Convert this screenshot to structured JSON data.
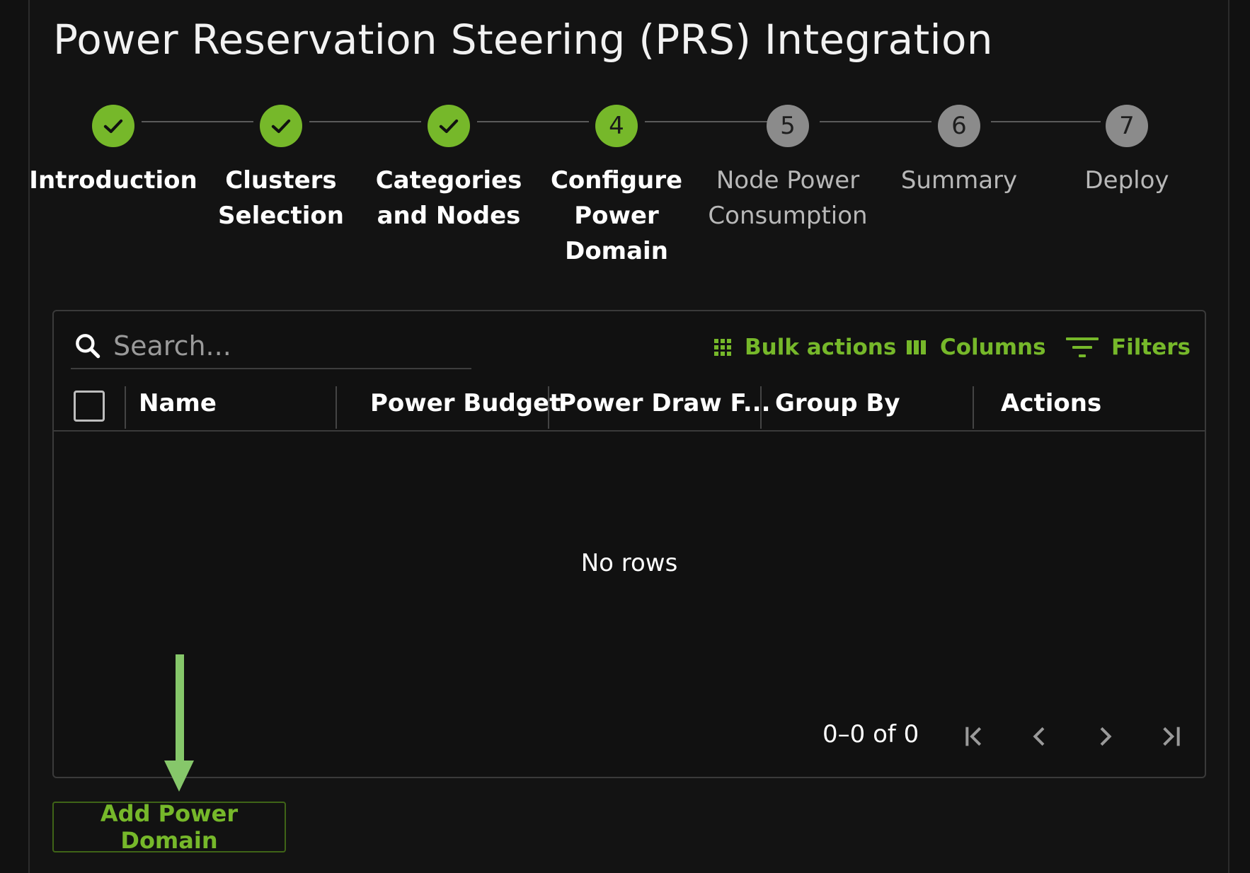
{
  "page": {
    "title": "Power Reservation Steering (PRS) Integration"
  },
  "stepper": {
    "steps": [
      {
        "number": "1",
        "label": "Introduction",
        "state": "done"
      },
      {
        "number": "2",
        "label": "Clusters\nSelection",
        "state": "done"
      },
      {
        "number": "3",
        "label": "Categories\nand Nodes",
        "state": "done"
      },
      {
        "number": "4",
        "label": "Configure\nPower\nDomain",
        "state": "active"
      },
      {
        "number": "5",
        "label": "Node Power\nConsumption",
        "state": "pending"
      },
      {
        "number": "6",
        "label": "Summary",
        "state": "pending"
      },
      {
        "number": "7",
        "label": "Deploy",
        "state": "pending"
      }
    ]
  },
  "grid": {
    "search": {
      "placeholder": "Search...",
      "value": "",
      "icon": "search-icon"
    },
    "toolbar": {
      "bulk_actions": {
        "label": "Bulk actions",
        "icon": "grid-dots-icon"
      },
      "columns": {
        "label": "Columns",
        "icon": "columns-icon"
      },
      "filters": {
        "label": "Filters",
        "icon": "filter-icon"
      }
    },
    "columns": [
      "Name",
      "Power Budget",
      "Power Draw F...",
      "Group By",
      "Actions"
    ],
    "rows": [],
    "empty_text": "No rows",
    "pagination": {
      "range_text": "0–0 of 0",
      "icons": [
        "first-page-icon",
        "previous-page-icon",
        "next-page-icon",
        "last-page-icon"
      ]
    }
  },
  "actions": {
    "add_power_domain": "Add Power Domain"
  },
  "colors": {
    "accent": "#76b82a",
    "pending": "#8b8b8b",
    "background": "#111111",
    "annotation_arrow": "#86c76a"
  }
}
